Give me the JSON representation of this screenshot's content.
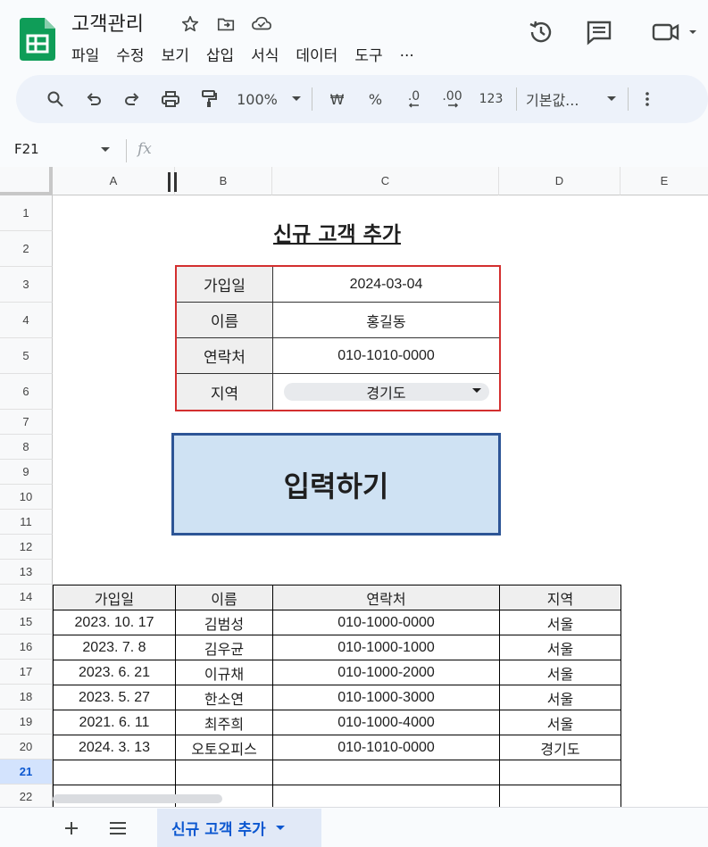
{
  "app": {
    "title": "고객관리",
    "menu": [
      "파일",
      "수정",
      "보기",
      "삽입",
      "서식",
      "데이터",
      "도구",
      "..."
    ]
  },
  "toolbar": {
    "zoom": "100%",
    "currency": "₩",
    "percent": "%",
    "dec_decrease": ".0",
    "dec_increase": ".00",
    "number_format": "123",
    "font": "기본값..."
  },
  "formula_bar": {
    "cell_ref": "F21",
    "fx": "fx"
  },
  "grid": {
    "columns": [
      "A",
      "B",
      "C",
      "D",
      "E"
    ],
    "rows": [
      "1",
      "2",
      "3",
      "4",
      "5",
      "6",
      "7",
      "8",
      "9",
      "10",
      "11",
      "12",
      "13",
      "14",
      "15",
      "16",
      "17",
      "18",
      "19",
      "20",
      "21",
      "22"
    ],
    "selected_row": "21"
  },
  "form": {
    "title": "신규 고객 추가",
    "fields": [
      {
        "label": "가입일",
        "value": "2024-03-04"
      },
      {
        "label": "이름",
        "value": "홍길동"
      },
      {
        "label": "연락처",
        "value": "010-1010-0000"
      },
      {
        "label": "지역",
        "value": "경기도"
      }
    ],
    "submit_label": "입력하기"
  },
  "table": {
    "headers": [
      "가입일",
      "이름",
      "연락처",
      "지역"
    ],
    "rows": [
      [
        "2023. 10. 17",
        "김범성",
        "010-1000-0000",
        "서울"
      ],
      [
        "2023. 7. 8",
        "김우균",
        "010-1000-1000",
        "서울"
      ],
      [
        "2023. 6. 21",
        "이규채",
        "010-1000-2000",
        "서울"
      ],
      [
        "2023. 5. 27",
        "한소연",
        "010-1000-3000",
        "서울"
      ],
      [
        "2021. 6. 11",
        "최주희",
        "010-1000-4000",
        "서울"
      ],
      [
        "2024. 3. 13",
        "오토오피스",
        "010-1010-0000",
        "경기도"
      ]
    ]
  },
  "sheets": {
    "active_tab": "신규 고객 추가"
  },
  "colors": {
    "form_border": "#d32f2f",
    "button_fill": "#cfe2f3",
    "button_border": "#2d5596",
    "sheets_green": "#0f9d58",
    "active_tab": "#0b57d0"
  }
}
